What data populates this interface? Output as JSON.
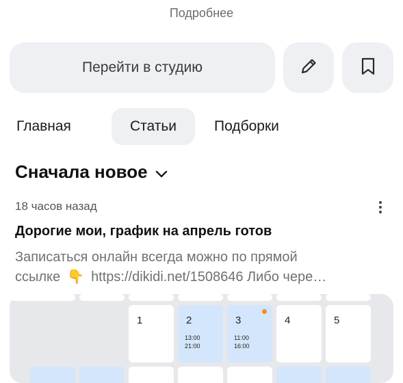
{
  "header": {
    "more_link": "Подробнее"
  },
  "actions": {
    "studio_button": "Перейти в студию"
  },
  "tabs": [
    {
      "label": "Главная"
    },
    {
      "label": "Статьи"
    },
    {
      "label": "Подборки"
    }
  ],
  "active_tab": "Статьи",
  "sort": {
    "label": "Сначала новое"
  },
  "post": {
    "time": "18 часов назад",
    "title": "Дорогие мои, график на апрель готов",
    "snippet_line1": "Записаться онлайн всегда можно по прямой",
    "snippet_line2_start": "ссылке",
    "snippet_line2_end": "https://dikidi.net/1508646  Либо чере…",
    "pointer_icon": "👇"
  },
  "calendar": {
    "days": [
      {
        "num": "1",
        "slots": []
      },
      {
        "num": "2",
        "slots": [
          "13:00",
          "21:00"
        ]
      },
      {
        "num": "3",
        "slots": [
          "11:00",
          "16:00"
        ]
      },
      {
        "num": "4",
        "slots": []
      },
      {
        "num": "5",
        "slots": []
      }
    ]
  },
  "icons": {
    "edit": "pencil-icon",
    "bookmark": "bookmark-icon",
    "sort": "chevron-down-icon",
    "menu": "more-vertical-icon"
  },
  "colors": {
    "button_bg": "#eef0f3",
    "calendar_highlight": "#d4e6fb",
    "notification_dot": "#f08a2a"
  }
}
